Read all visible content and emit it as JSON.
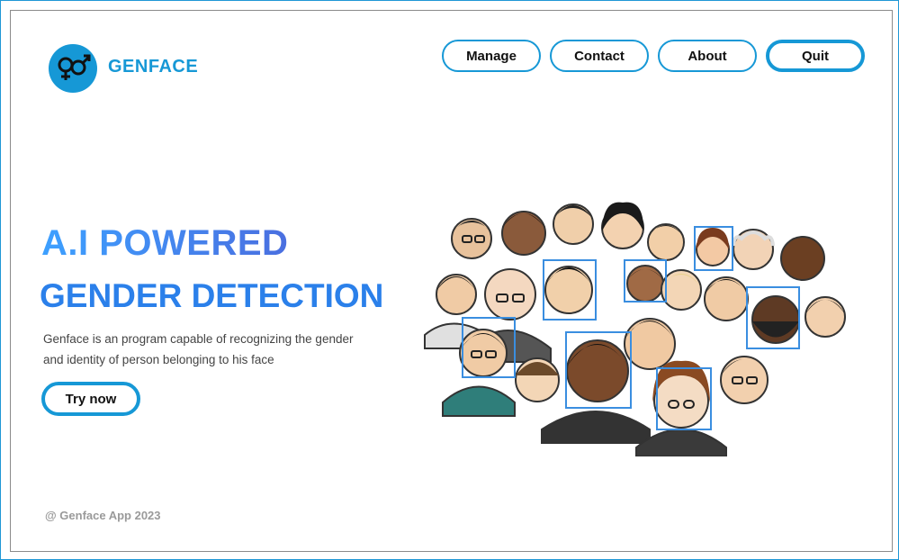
{
  "app": {
    "brand": "GENFACE",
    "logo_icon": "gender-symbols-icon"
  },
  "nav": {
    "manage": "Manage",
    "contact": "Contact",
    "about": "About",
    "quit": "Quit"
  },
  "hero": {
    "line1": "A.I POWERED",
    "line2": "GENDER DETECTION",
    "description_line1": "Genface is an program capable of recognizing the gender",
    "description_line2": "and identity of person belonging to his face",
    "cta": "Try now"
  },
  "illustration": {
    "name": "crowd-face-detection-illustration"
  },
  "footer": {
    "copyright": "@ Genface App 2023"
  },
  "colors": {
    "accent": "#1698d6",
    "heading_blue": "#2b80ea",
    "detection_box": "#3a8ee0"
  }
}
